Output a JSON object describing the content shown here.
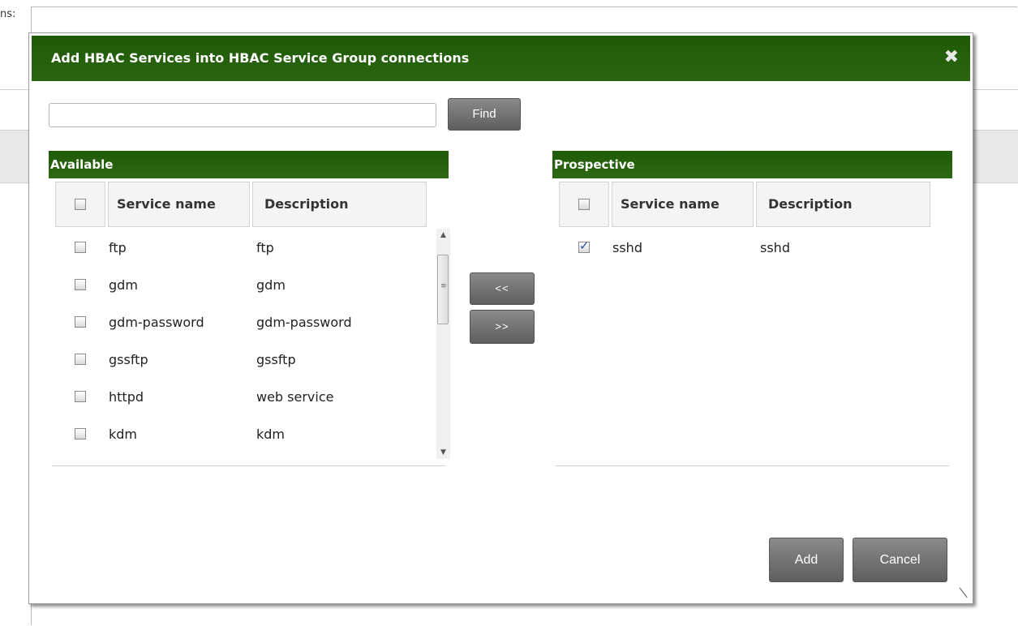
{
  "background": {
    "label": "ns:"
  },
  "dialog": {
    "title": "Add HBAC Services into HBAC Service Group connections",
    "close_icon": "close-icon",
    "search": {
      "value": "",
      "placeholder": ""
    },
    "find_label": "Find",
    "move_left_label": "<<",
    "move_right_label": ">>",
    "add_label": "Add",
    "cancel_label": "Cancel"
  },
  "available": {
    "title": "Available",
    "columns": [
      "Service name",
      "Description"
    ],
    "rows": [
      {
        "name": "ftp",
        "description": "ftp",
        "checked": false
      },
      {
        "name": "gdm",
        "description": "gdm",
        "checked": false
      },
      {
        "name": "gdm-password",
        "description": "gdm-password",
        "checked": false
      },
      {
        "name": "gssftp",
        "description": "gssftp",
        "checked": false
      },
      {
        "name": "httpd",
        "description": "web service",
        "checked": false
      },
      {
        "name": "kdm",
        "description": "kdm",
        "checked": false
      }
    ]
  },
  "prospective": {
    "title": "Prospective",
    "columns": [
      "Service name",
      "Description"
    ],
    "rows": [
      {
        "name": "sshd",
        "description": "sshd",
        "checked": true
      }
    ]
  },
  "colors": {
    "header_green": "#235d0b",
    "button_gray": "#6e6e6e"
  }
}
